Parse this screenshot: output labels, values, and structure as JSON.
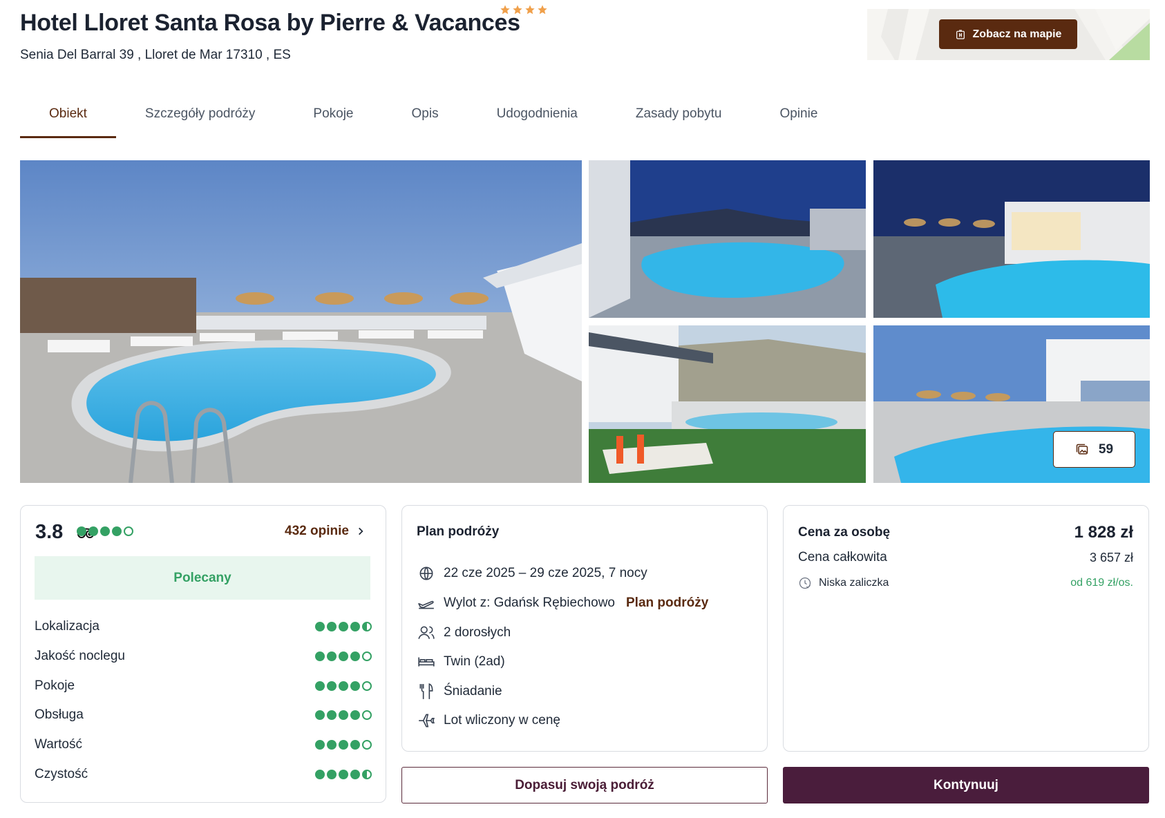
{
  "hotel": {
    "name": "Hotel Lloret Santa Rosa by Pierre & Vacances",
    "stars": 4,
    "address": "Senia Del Barral 39 , Lloret de Mar 17310 , ES",
    "map_button": "Zobacz na mapie"
  },
  "tabs": [
    {
      "label": "Obiekt",
      "active": true
    },
    {
      "label": "Szczegóły podróży",
      "active": false
    },
    {
      "label": "Pokoje",
      "active": false
    },
    {
      "label": "Opis",
      "active": false
    },
    {
      "label": "Udogodnienia",
      "active": false
    },
    {
      "label": "Zasady pobytu",
      "active": false
    },
    {
      "label": "Opinie",
      "active": false
    }
  ],
  "gallery": {
    "photo_count": "59"
  },
  "rating": {
    "score": "3.8",
    "overall_dots": 4,
    "reviews_link": "432 opinie",
    "recommended": "Polecany",
    "metrics": [
      {
        "label": "Lokalizacja",
        "value": 4.5
      },
      {
        "label": "Jakość noclegu",
        "value": 4
      },
      {
        "label": "Pokoje",
        "value": 4
      },
      {
        "label": "Obsługa",
        "value": 4
      },
      {
        "label": "Wartość",
        "value": 4
      },
      {
        "label": "Czystość",
        "value": 4.5
      }
    ]
  },
  "plan": {
    "title": "Plan podróży",
    "dates": "22 cze 2025 – 29 cze 2025, 7 nocy",
    "departure": "Wylot z: Gdańsk Rębiechowo",
    "departure_link": "Plan podróży",
    "guests": "2 dorosłych",
    "room": "Twin (2ad)",
    "board": "Śniadanie",
    "flight": "Lot wliczony w cenę"
  },
  "price": {
    "per_person_label": "Cena za osobę",
    "per_person_value": "1 828 zł",
    "total_label": "Cena całkowita",
    "total_value": "3 657 zł",
    "deposit_label": "Niska zaliczka",
    "deposit_value": "od 619 zł/os."
  },
  "actions": {
    "adjust": "Dopasuj swoją podróż",
    "continue": "Kontynuuj"
  },
  "colors": {
    "brand_brown": "#5a2a10",
    "brand_plum": "#4a1d3c",
    "rating_green": "#34a164",
    "star_orange": "#f0a04b"
  }
}
